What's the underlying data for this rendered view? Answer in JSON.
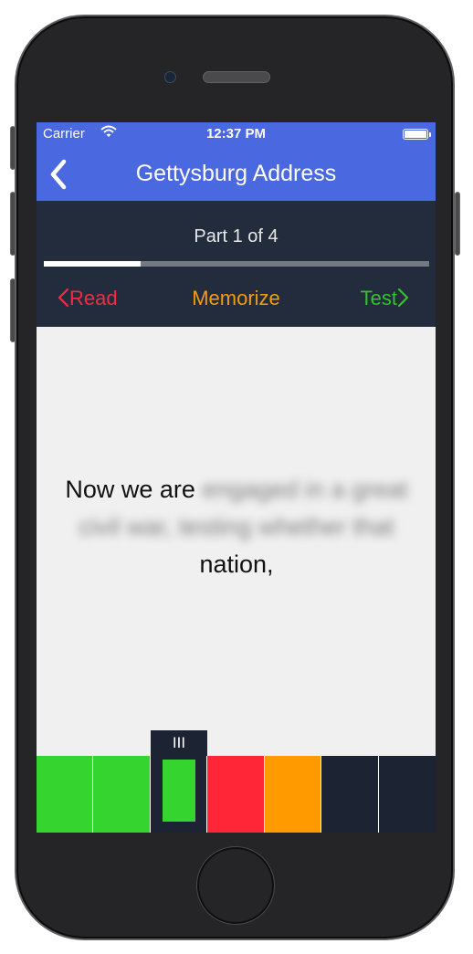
{
  "status_bar": {
    "carrier": "Carrier",
    "time": "12:37 PM",
    "wifi_icon": "wifi-icon",
    "battery_icon": "battery-icon"
  },
  "nav_bar": {
    "title": "Gettysburg Address",
    "back_icon": "chevron-left-icon"
  },
  "progress": {
    "label": "Part 1 of 4",
    "fraction": 0.25
  },
  "modes": {
    "read": "Read",
    "memorize": "Memorize",
    "test": "Test"
  },
  "verse": {
    "visible_start": "Now we are",
    "hidden_text": "engaged in a great civil war, testing whether that",
    "visible_end": "nation,"
  },
  "word_strip": {
    "indicator_label": "III",
    "cells": [
      {
        "state": "correct",
        "color": "#36d42e"
      },
      {
        "state": "correct",
        "color": "#36d42e"
      },
      {
        "state": "current",
        "color": "#36d42e"
      },
      {
        "state": "wrong",
        "color": "#ff2638"
      },
      {
        "state": "hint",
        "color": "#ff9a00"
      },
      {
        "state": "empty",
        "color": "#1c2433"
      },
      {
        "state": "empty",
        "color": "#1c2433"
      }
    ]
  },
  "colors": {
    "nav_blue": "#4a68e0",
    "panel_dark": "#222c3c",
    "read_red": "#ef2d44",
    "memorize_orange": "#f49b10",
    "test_green": "#2fc52a"
  }
}
